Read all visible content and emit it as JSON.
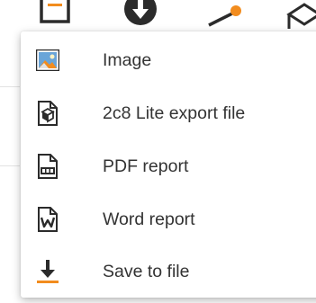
{
  "colors": {
    "text": "#333333",
    "icon_dark": "#2b2b2b",
    "accent_orange": "#f28c1e",
    "image_icon_blue": "#6aa5d8"
  },
  "toolbar": {
    "icons": [
      "document-icon",
      "download-circle-icon",
      "node-link-icon",
      "box-icon"
    ]
  },
  "menu": {
    "items": [
      {
        "label": "Image",
        "icon": "image-icon"
      },
      {
        "label": "2c8 Lite export file",
        "icon": "cube-file-icon"
      },
      {
        "label": "PDF report",
        "icon": "pdf-file-icon"
      },
      {
        "label": "Word report",
        "icon": "word-file-icon"
      },
      {
        "label": "Save to file",
        "icon": "save-download-icon"
      }
    ]
  }
}
